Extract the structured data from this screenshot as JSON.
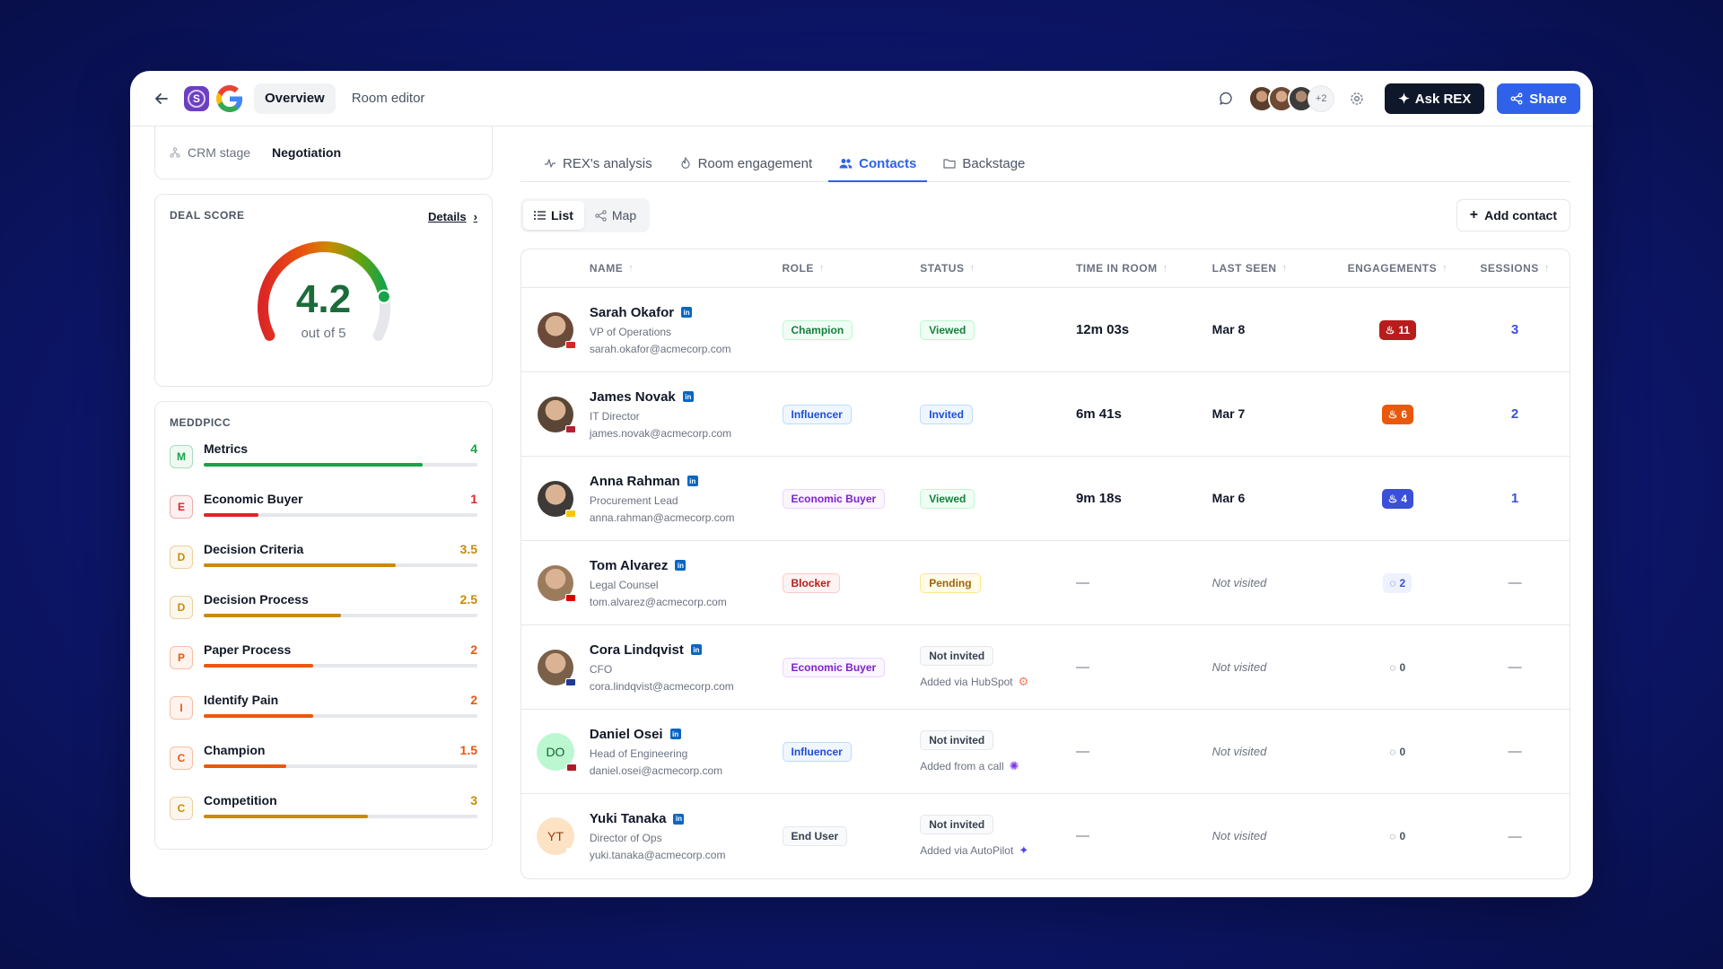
{
  "topbar": {
    "tabs": [
      "Overview",
      "Room editor"
    ],
    "logo_letter": "S",
    "avatars_more": "+2",
    "ask_label": "Ask REX",
    "share_label": "Share"
  },
  "crm": {
    "label": "CRM stage",
    "value": "Negotiation"
  },
  "deal_score": {
    "title": "DEAL SCORE",
    "details": "Details",
    "score": "4.2",
    "out_of": "out of 5",
    "fraction": 0.84
  },
  "meddpicc": {
    "title": "MEDDPICC",
    "items": [
      {
        "letter": "M",
        "label": "Metrics",
        "score": "4",
        "fraction": 0.8,
        "color": "#16a34a"
      },
      {
        "letter": "E",
        "label": "Economic Buyer",
        "score": "1",
        "fraction": 0.2,
        "color": "#dc2626"
      },
      {
        "letter": "D",
        "label": "Decision Criteria",
        "score": "3.5",
        "fraction": 0.7,
        "color": "#ca8a04"
      },
      {
        "letter": "D",
        "label": "Decision Process",
        "score": "2.5",
        "fraction": 0.5,
        "color": "#ca8a04"
      },
      {
        "letter": "P",
        "label": "Paper Process",
        "score": "2",
        "fraction": 0.4,
        "color": "#ea580c"
      },
      {
        "letter": "I",
        "label": "Identify Pain",
        "score": "2",
        "fraction": 0.4,
        "color": "#ea580c"
      },
      {
        "letter": "C",
        "label": "Champion",
        "score": "1.5",
        "fraction": 0.3,
        "color": "#ea580c"
      },
      {
        "letter": "C",
        "label": "Competition",
        "score": "3",
        "fraction": 0.6,
        "color": "#ca8a04"
      }
    ]
  },
  "tabs": [
    "REX's analysis",
    "Room engagement",
    "Contacts",
    "Backstage"
  ],
  "view": {
    "list": "List",
    "map": "Map",
    "add_contact": "Add contact"
  },
  "columns": [
    "NAME",
    "ROLE",
    "STATUS",
    "TIME IN ROOM",
    "LAST SEEN",
    "ENGAGEMENTS",
    "SESSIONS"
  ],
  "contacts": [
    {
      "name": "Sarah Okafor",
      "title": "VP of Operations",
      "email": "sarah.okafor@acmecorp.com",
      "role": "Champion",
      "role_style": "b-green",
      "status": "Viewed",
      "status_style": "b-green",
      "added": "",
      "time": "12m 03s",
      "last_seen": "Mar 8",
      "eng": "11",
      "eng_style": "eng-red",
      "sessions": "3",
      "avatar_color": "#6b4a3a",
      "flag": "#d62828",
      "initials": ""
    },
    {
      "name": "James Novak",
      "title": "IT Director",
      "email": "james.novak@acmecorp.com",
      "role": "Influencer",
      "role_style": "b-blue",
      "status": "Invited",
      "status_style": "b-blue",
      "added": "",
      "time": "6m 41s",
      "last_seen": "Mar 7",
      "eng": "6",
      "eng_style": "eng-orange",
      "sessions": "2",
      "avatar_color": "#5a4636",
      "flag": "#b22234",
      "initials": ""
    },
    {
      "name": "Anna Rahman",
      "title": "Procurement Lead",
      "email": "anna.rahman@acmecorp.com",
      "role": "Economic Buyer",
      "role_style": "b-purple",
      "status": "Viewed",
      "status_style": "b-green",
      "added": "",
      "time": "9m 18s",
      "last_seen": "Mar 6",
      "eng": "4",
      "eng_style": "eng-blue",
      "sessions": "1",
      "avatar_color": "#3d3a38",
      "flag": "#f6c800",
      "initials": ""
    },
    {
      "name": "Tom Alvarez",
      "title": "Legal Counsel",
      "email": "tom.alvarez@acmecorp.com",
      "role": "Blocker",
      "role_style": "b-red",
      "status": "Pending",
      "status_style": "b-yellow",
      "added": "",
      "time": "—",
      "last_seen": "Not visited",
      "eng": "2",
      "eng_style": "eng-light",
      "sessions": "—",
      "avatar_color": "#9c7a5c",
      "flag": "#dd0000",
      "initials": ""
    },
    {
      "name": "Cora Lindqvist",
      "title": "CFO",
      "email": "cora.lindqvist@acmecorp.com",
      "role": "Economic Buyer",
      "role_style": "b-purple",
      "status": "Not invited",
      "status_style": "b-gray",
      "added": "Added via HubSpot",
      "time": "—",
      "last_seen": "Not visited",
      "eng": "0",
      "eng_style": "eng-none",
      "sessions": "—",
      "avatar_color": "#7a6048",
      "flag": "#1f3a93",
      "initials": ""
    },
    {
      "name": "Daniel Osei",
      "title": "Head of Engineering",
      "email": "daniel.osei@acmecorp.com",
      "role": "Influencer",
      "role_style": "b-blue",
      "status": "Not invited",
      "status_style": "b-gray",
      "added": "Added from a call",
      "time": "—",
      "last_seen": "Not visited",
      "eng": "0",
      "eng_style": "eng-none",
      "sessions": "—",
      "avatar_color": "#bbf7d0",
      "flag": "#ae1c28",
      "initials": "DO"
    },
    {
      "name": "Yuki Tanaka",
      "title": "Director of Ops",
      "email": "yuki.tanaka@acmecorp.com",
      "role": "End User",
      "role_style": "b-gray",
      "status": "Not invited",
      "status_style": "b-gray",
      "added": "Added via AutoPilot",
      "time": "—",
      "last_seen": "Not visited",
      "eng": "0",
      "eng_style": "eng-none",
      "sessions": "—",
      "avatar_color": "#fde2c4",
      "flag": "#ffffff",
      "initials": "YT"
    }
  ]
}
